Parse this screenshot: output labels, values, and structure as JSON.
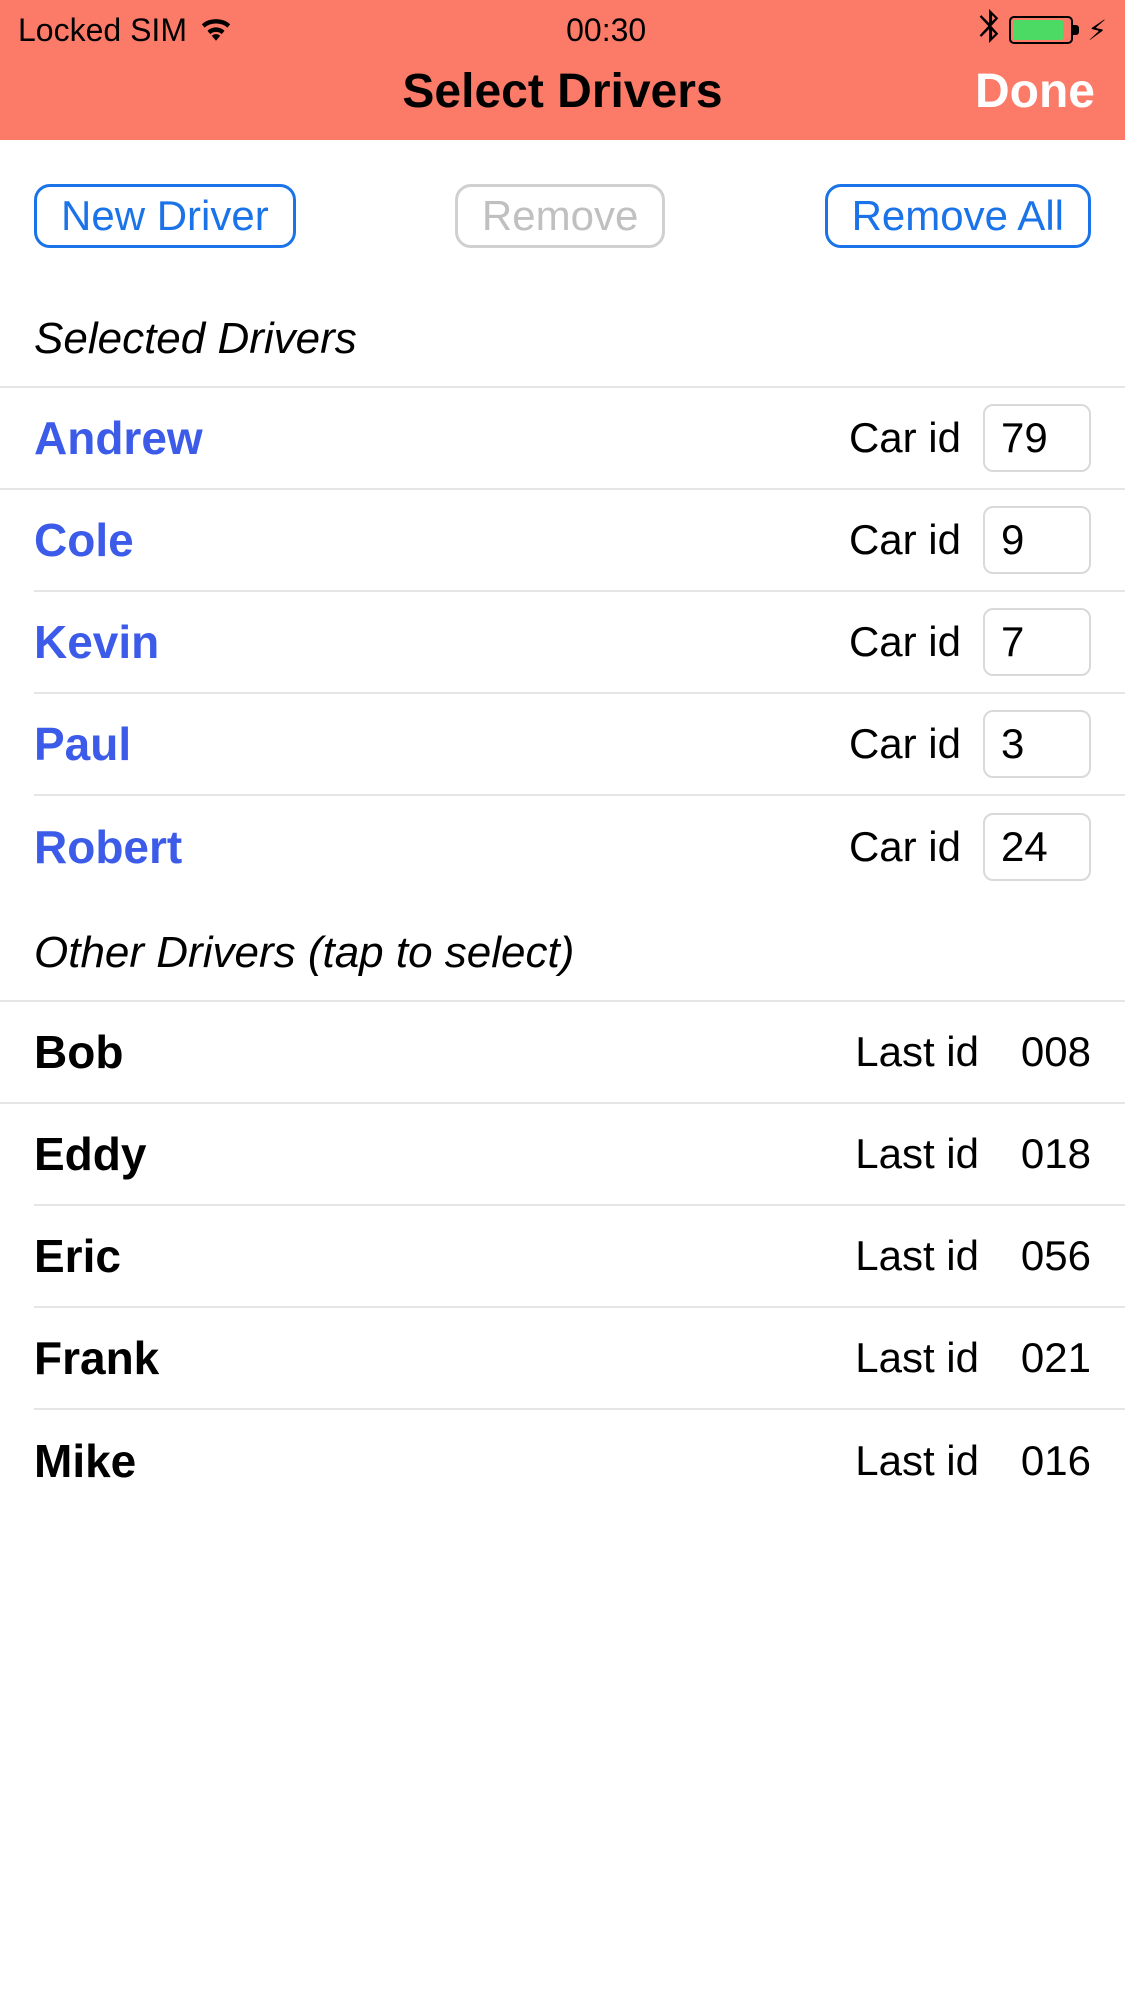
{
  "status": {
    "carrier": "Locked SIM",
    "time": "00:30"
  },
  "nav": {
    "title": "Select Drivers",
    "done": "Done"
  },
  "toolbar": {
    "new_driver": "New Driver",
    "remove": "Remove",
    "remove_all": "Remove All"
  },
  "sections": {
    "selected": "Selected Drivers",
    "other": "Other Drivers (tap to select)"
  },
  "labels": {
    "car_id": "Car id",
    "last_id": "Last id"
  },
  "selected_drivers": [
    {
      "name": "Andrew",
      "car_id": "79"
    },
    {
      "name": "Cole",
      "car_id": "9"
    },
    {
      "name": "Kevin",
      "car_id": "7"
    },
    {
      "name": "Paul",
      "car_id": "3"
    },
    {
      "name": "Robert",
      "car_id": "24"
    }
  ],
  "other_drivers": [
    {
      "name": "Bob",
      "last_id": "008"
    },
    {
      "name": "Eddy",
      "last_id": "018"
    },
    {
      "name": "Eric",
      "last_id": "056"
    },
    {
      "name": "Frank",
      "last_id": "021"
    },
    {
      "name": "Mike",
      "last_id": "016"
    }
  ]
}
